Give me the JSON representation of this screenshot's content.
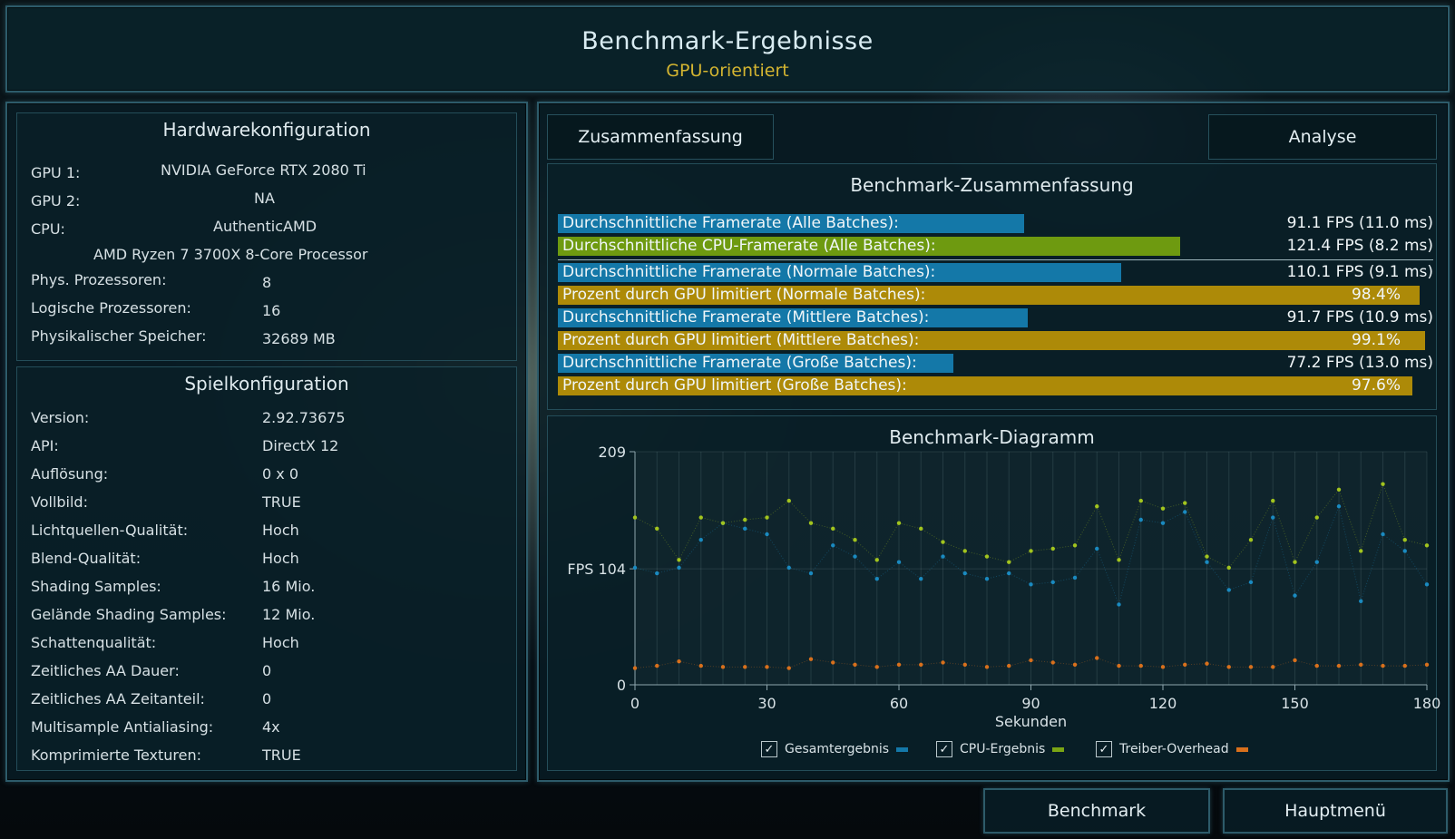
{
  "header": {
    "title": "Benchmark-Ergebnisse",
    "subtitle": "GPU-orientiert"
  },
  "hardware": {
    "title": "Hardwarekonfiguration",
    "gpu1_label": "GPU 1:",
    "gpu1_value": "NVIDIA GeForce RTX 2080 Ti",
    "gpu2_label": "GPU 2:",
    "gpu2_value": "NA",
    "cpu_label": "CPU:",
    "cpu_vendor": "AuthenticAMD",
    "cpu_name": "AMD Ryzen 7 3700X 8-Core Processor",
    "rows": [
      {
        "label": "Phys. Prozessoren:",
        "value": "8"
      },
      {
        "label": "Logische Prozessoren:",
        "value": "16"
      },
      {
        "label": "Physikalischer Speicher:",
        "value": "32689  MB"
      }
    ]
  },
  "game": {
    "title": "Spielkonfiguration",
    "rows": [
      {
        "label": "Version:",
        "value": "2.92.73675"
      },
      {
        "label": "API:",
        "value": "DirectX 12"
      },
      {
        "label": "Auflösung:",
        "value": "0 x 0"
      },
      {
        "label": "Vollbild:",
        "value": "TRUE"
      },
      {
        "label": "Lichtquellen-Qualität:",
        "value": "Hoch"
      },
      {
        "label": "Blend-Qualität:",
        "value": "Hoch"
      },
      {
        "label": "Shading Samples:",
        "value": "16 Mio."
      },
      {
        "label": "Gelände Shading Samples:",
        "value": "12 Mio."
      },
      {
        "label": "Schattenqualität:",
        "value": "Hoch"
      },
      {
        "label": "Zeitliches AA Dauer:",
        "value": "0"
      },
      {
        "label": "Zeitliches AA Zeitanteil:",
        "value": "0"
      },
      {
        "label": "Multisample Antialiasing:",
        "value": "4x"
      },
      {
        "label": "Komprimierte Texturen:",
        "value": "TRUE"
      }
    ]
  },
  "tabs": {
    "summary": "Zusammenfassung",
    "analysis": "Analyse"
  },
  "summary": {
    "title": "Benchmark-Zusammenfassung",
    "rows": [
      {
        "label": "Durchschnittliche Framerate (Alle Batches):",
        "value": "91.1 FPS (11.0 ms)",
        "fraction": 0.533,
        "kind": "gpu"
      },
      {
        "label": "Durchschnittliche CPU-Framerate (Alle Batches):",
        "value": "121.4 FPS (8.2 ms)",
        "fraction": 0.711,
        "kind": "cpu"
      },
      {
        "label": "Durchschnittliche Framerate (Normale Batches):",
        "value": "110.1 FPS (9.1 ms)",
        "fraction": 0.644,
        "kind": "gpu"
      },
      {
        "label": "Prozent durch GPU limitiert (Normale Batches):",
        "value": "98.4%",
        "fraction": 0.984,
        "kind": "pct"
      },
      {
        "label": "Durchschnittliche Framerate (Mittlere Batches):",
        "value": "91.7 FPS (10.9 ms)",
        "fraction": 0.537,
        "kind": "gpu"
      },
      {
        "label": "Prozent durch GPU limitiert (Mittlere Batches):",
        "value": "99.1%",
        "fraction": 0.991,
        "kind": "pct"
      },
      {
        "label": "Durchschnittliche Framerate (Große Batches):",
        "value": "77.2 FPS (13.0 ms)",
        "fraction": 0.452,
        "kind": "gpu"
      },
      {
        "label": "Prozent durch GPU limitiert (Große Batches):",
        "value": "97.6%",
        "fraction": 0.976,
        "kind": "pct"
      }
    ]
  },
  "colors": {
    "gpu": "#1478a8",
    "cpu": "#6e9a10",
    "pct": "#ad8a08",
    "overhead": "#d8701c"
  },
  "chart_data": {
    "type": "scatter",
    "title": "Benchmark-Diagramm",
    "xlabel": "Sekunden",
    "ylabel": "FPS",
    "xlim": [
      0,
      180
    ],
    "ylim": [
      0,
      209
    ],
    "xticks": [
      0,
      30,
      60,
      90,
      120,
      150,
      180
    ],
    "yticks": [
      0,
      104,
      209
    ],
    "ytick_labels": [
      "0",
      "FPS 104",
      "209"
    ],
    "series": [
      {
        "name": "Gesamtergebnis",
        "color": "#1a8ac0",
        "x": [
          0,
          5,
          10,
          15,
          20,
          25,
          30,
          35,
          40,
          45,
          50,
          55,
          60,
          65,
          70,
          75,
          80,
          85,
          90,
          95,
          100,
          105,
          110,
          115,
          120,
          125,
          130,
          135,
          140,
          145,
          150,
          155,
          160,
          165,
          170,
          175,
          180
        ],
        "y": [
          105,
          100,
          105,
          130,
          145,
          140,
          135,
          105,
          100,
          125,
          115,
          95,
          110,
          95,
          115,
          100,
          95,
          100,
          90,
          92,
          96,
          122,
          72,
          148,
          145,
          155,
          110,
          85,
          92,
          150,
          80,
          110,
          160,
          75,
          135,
          120,
          90
        ]
      },
      {
        "name": "CPU-Ergebnis",
        "color": "#a2c41e",
        "x": [
          0,
          5,
          10,
          15,
          20,
          25,
          30,
          35,
          40,
          45,
          50,
          55,
          60,
          65,
          70,
          75,
          80,
          85,
          90,
          95,
          100,
          105,
          110,
          115,
          120,
          125,
          130,
          135,
          140,
          145,
          150,
          155,
          160,
          165,
          170,
          175,
          180
        ],
        "y": [
          150,
          140,
          112,
          150,
          145,
          148,
          150,
          165,
          145,
          140,
          130,
          112,
          145,
          140,
          128,
          120,
          115,
          110,
          120,
          122,
          125,
          160,
          112,
          165,
          158,
          163,
          115,
          105,
          130,
          165,
          110,
          150,
          175,
          120,
          180,
          130,
          125
        ]
      },
      {
        "name": "Treiber-Overhead",
        "color": "#d8701c",
        "x": [
          0,
          5,
          10,
          15,
          20,
          25,
          30,
          35,
          40,
          45,
          50,
          55,
          60,
          65,
          70,
          75,
          80,
          85,
          90,
          95,
          100,
          105,
          110,
          115,
          120,
          125,
          130,
          135,
          140,
          145,
          150,
          155,
          160,
          165,
          170,
          175,
          180
        ],
        "y": [
          15,
          17,
          21,
          17,
          16,
          16,
          16,
          15,
          23,
          20,
          18,
          16,
          18,
          18,
          20,
          18,
          16,
          17,
          22,
          20,
          18,
          24,
          17,
          17,
          16,
          18,
          19,
          16,
          16,
          16,
          22,
          17,
          17,
          18,
          17,
          17,
          18
        ]
      }
    ]
  },
  "legend": {
    "gpu": "Gesamtergebnis",
    "cpu": "CPU-Ergebnis",
    "overhead": "Treiber-Overhead",
    "check": "✓"
  },
  "buttons": {
    "benchmark": "Benchmark",
    "mainmenu": "Hauptmenü"
  }
}
